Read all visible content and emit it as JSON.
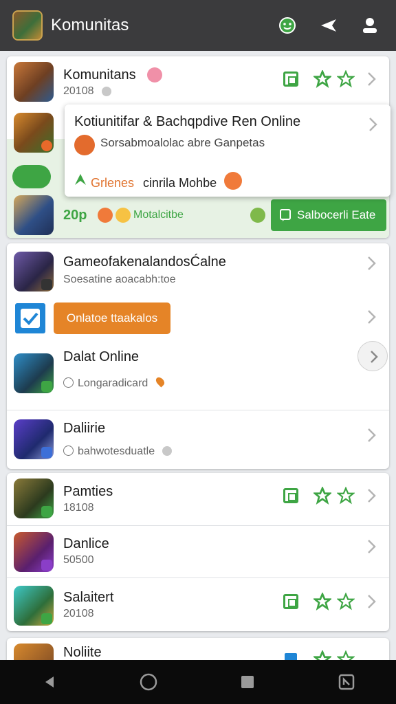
{
  "app": {
    "title": "Komunitas"
  },
  "topbar": {
    "icons": [
      "chat-icon",
      "share-icon",
      "profile-icon"
    ]
  },
  "card1": {
    "row1": {
      "name": "Komunitans",
      "sub": "20108"
    },
    "popup": {
      "title": "Kotiunitifar & Bachqpdive Ren Online",
      "sub": "Sorsabmoalolac abre Ganpetas",
      "foot_green": "Grlenes",
      "foot_text": "cinrila Mohbe"
    },
    "row3": {
      "count": "20p",
      "label": "Motalcitbe",
      "button": "Salbocerli Eate"
    }
  },
  "card2": {
    "row1": {
      "name": "GameofakenalandosĆalne",
      "sub": "Soesatine aoacabh:toe"
    },
    "row2": {
      "button": "Onlatoe ttaakalos"
    },
    "row3": {
      "name": "Dalat Online",
      "sub": "Longaradicard"
    },
    "row4": {
      "name": "Daliirie",
      "sub": "bahwotesduatle"
    }
  },
  "card3": {
    "row1": {
      "name": "Pamties",
      "sub": "18108"
    },
    "row2": {
      "name": "Danlice",
      "sub": "50500"
    },
    "row3": {
      "name": "Salaitert",
      "sub": "20108"
    }
  },
  "card4": {
    "row1": {
      "name": "Noliite"
    }
  },
  "colors": {
    "accent_green": "#3ea544",
    "accent_orange": "#e58427",
    "topbar": "#3b3b3d"
  }
}
